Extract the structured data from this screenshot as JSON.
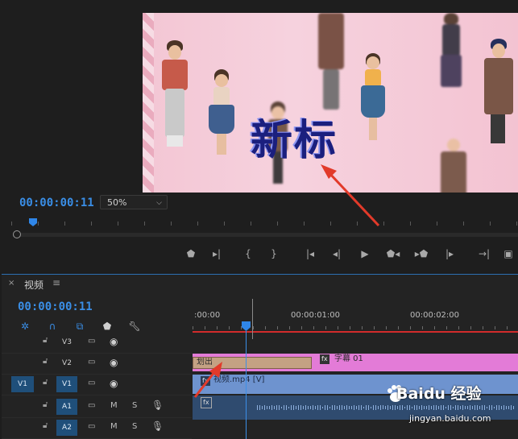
{
  "monitor": {
    "timecode": "00:00:00:11",
    "zoom_value": "50%",
    "zoom_chevron_icon": "chevron-down-icon",
    "video_overlay_text": "新标",
    "transport_icons": [
      "add-marker-icon",
      "mark-in-out-icon",
      "mark-in-icon",
      "mark-out-icon",
      "go-to-in-icon",
      "step-back-icon",
      "play-icon",
      "step-forward-icon",
      "go-to-out-icon",
      "insert-icon",
      "overwrite-icon",
      "export-frame-icon"
    ]
  },
  "timeline": {
    "panel_title": "视频",
    "close_glyph": "×",
    "menu_glyph": "≡",
    "timecode": "00:00:00:11",
    "ruler_labels": [
      ":00:00",
      "00:00:01:00",
      "00:00:02:00"
    ],
    "tracks": [
      {
        "source": "",
        "name": "V3",
        "active": false,
        "kind": "video"
      },
      {
        "source": "",
        "name": "V2",
        "active": false,
        "kind": "video"
      },
      {
        "source": "V1",
        "name": "V1",
        "active": true,
        "kind": "video"
      },
      {
        "source": "",
        "name": "A1",
        "active": true,
        "kind": "audio"
      },
      {
        "source": "",
        "name": "A2",
        "active": true,
        "kind": "audio"
      }
    ],
    "audio_m": "M",
    "audio_s": "S",
    "clips": {
      "graphic_label": "字幕 01",
      "graphic_fx": "fx",
      "transition_label": "划出",
      "video_label": "视频.mp4 [V]",
      "video_fx": "fx",
      "audio_fx": "fx"
    }
  },
  "watermark": {
    "brand": "Baidu 经验",
    "url": "jingyan.baidu.com"
  },
  "colors": {
    "accent": "#3a8ee6",
    "graphic_clip": "#e37bd7",
    "video_clip": "#6e93cf",
    "audio_clip": "#2f4b6f",
    "transition": "#c4a183",
    "work_area": "#d22b2b"
  }
}
